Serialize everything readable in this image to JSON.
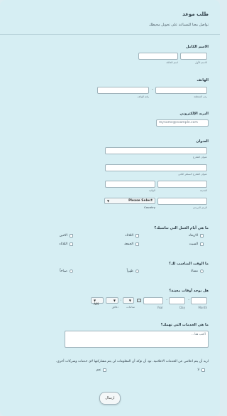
{
  "header": {
    "title": "طلب موعد",
    "subtitle": "تواصل معنا للمساعد على تحويل محيطك"
  },
  "name": {
    "label": "الاسم الكامل",
    "first_sub": "الاسم الأول",
    "last_sub": "اسم العائلة"
  },
  "phone": {
    "label": "الهاتف",
    "area_sub": "رمز المنطقة",
    "number_sub": "رقم الهاتف"
  },
  "email": {
    "label": "البريد الإلكتروني",
    "placeholder": "myname@example.com"
  },
  "address": {
    "label": "العنوان",
    "street1_sub": "عنوان الشارع",
    "street2_sub": "عنوان الشارع السطر الثاني",
    "city_sub": "المدينة",
    "state_sub": "الولاية",
    "zip_sub": "الرمز البريدي",
    "country_value": "Please Select",
    "country_sub": "Country"
  },
  "days": {
    "label": "ما هي أيام العمل التي تناسبك؟",
    "options": [
      "الاربعاء",
      "الثلاثاء",
      "الاثنين",
      "السبت",
      "الجمعة",
      "الثلاثاء"
    ]
  },
  "time": {
    "label": "ما الوقت المناسب لك؟",
    "options": [
      "مساءً",
      "ظهراً",
      "صباحاً"
    ]
  },
  "datetime": {
    "label": "هل يوجد أوقات معينة؟",
    "month_sub": "Month",
    "day_sub": "Day",
    "year_sub": "Year",
    "hour_sub": "ساعات",
    "minute_sub": "دقائق",
    "ampm_value": "AM"
  },
  "services": {
    "label": "ما هي الخدمات التي تهمك؟",
    "placeholder": "اكتب هنا..."
  },
  "consent": {
    "label": "اريد أن يتم اعلامي عن الخدمات الاعلامية. نود أن نؤكد أن المعلومات لن يتم مشاركتها لاي خدمات وشركات أخرى.",
    "options": [
      "لا",
      "نعم"
    ]
  },
  "submit": {
    "label": "ارسال"
  },
  "colors": {
    "bg": "#d6eef3",
    "border": "#9fb3bb"
  }
}
